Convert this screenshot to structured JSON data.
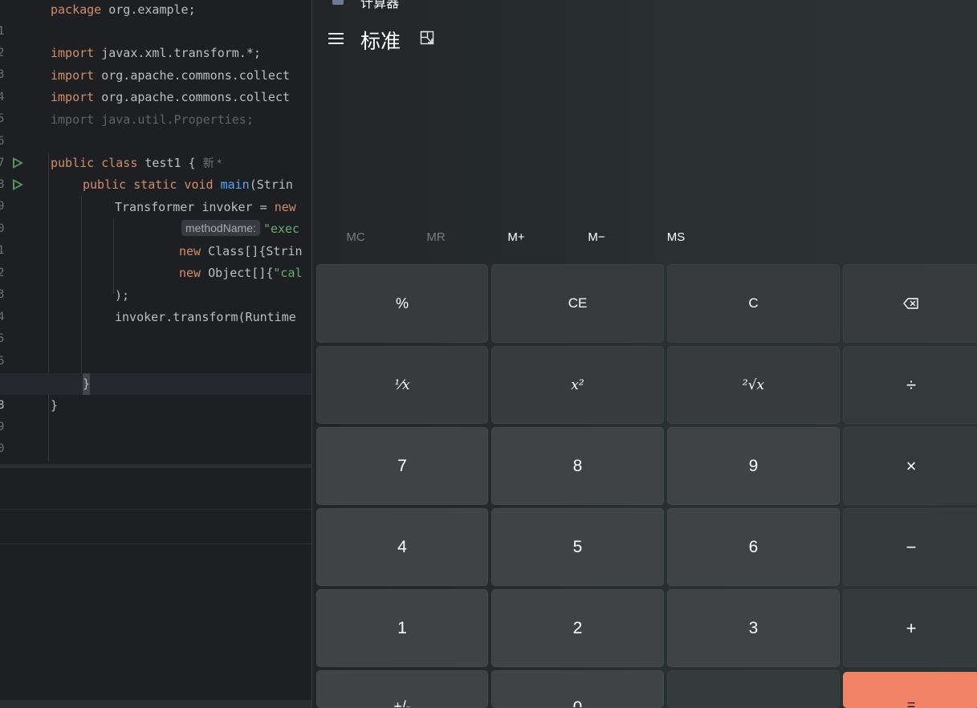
{
  "ide": {
    "line_numbers": [
      "1",
      "2",
      "3",
      "4",
      "5",
      "6",
      "7",
      "8",
      "9",
      "0",
      "1",
      "2",
      "3",
      "4",
      "5",
      "6",
      "7",
      "8",
      "9",
      "0"
    ],
    "lines": {
      "l1_kw": "package",
      "l1_rest": " org.example;",
      "l3_kw": "import",
      "l3_rest": " javax.xml.transform.*;",
      "l4_kw": "import",
      "l4_rest": " org.apache.commons.collect",
      "l5_kw": "import",
      "l5_rest": " org.apache.commons.collect",
      "l6": "import java.util.Properties;",
      "l8_kw": "public class",
      "l8_rest": " test1 { ",
      "l8_hint": "新 *",
      "l9_kw": "public static void",
      "l9_fn": "main",
      "l9_rest": "(Strin",
      "l10_a": "Transformer invoker = ",
      "l10_kw": "new",
      "l11_hint": "methodName:",
      "l11_str": "\"exec",
      "l12_kw": "new",
      "l12_rest": " Class[]{Strin",
      "l13_kw": "new",
      "l13_rest": " Object[]{",
      "l13_str": "\"cal",
      "l14": ");",
      "l15": "invoker.transform(Runtime",
      "l18": "}",
      "l19": "}"
    }
  },
  "calc": {
    "app_title": "计算器",
    "mode_title": "标准",
    "icons": {
      "app": "calculator-app-icon",
      "menu": "hamburger-menu-icon",
      "keep_on_top": "keep-on-top-icon",
      "backspace": "backspace-icon"
    },
    "memory": {
      "mc": "MC",
      "mr": "MR",
      "mplus": "M+",
      "mminus": "M−",
      "ms": "MS"
    },
    "keys": {
      "percent": "%",
      "ce": "CE",
      "c": "C",
      "reciprocal": "⅟x",
      "square": "x²",
      "sqrt": "²√x",
      "divide": "÷",
      "seven": "7",
      "eight": "8",
      "nine": "9",
      "multiply": "×",
      "four": "4",
      "five": "5",
      "six": "6",
      "minus": "−",
      "one": "1",
      "two": "2",
      "three": "3",
      "plus": "+",
      "negate": "+/-",
      "zero": "0",
      "decimal": ".",
      "equals": "="
    },
    "colors": {
      "equals_key": "#f28264"
    }
  }
}
